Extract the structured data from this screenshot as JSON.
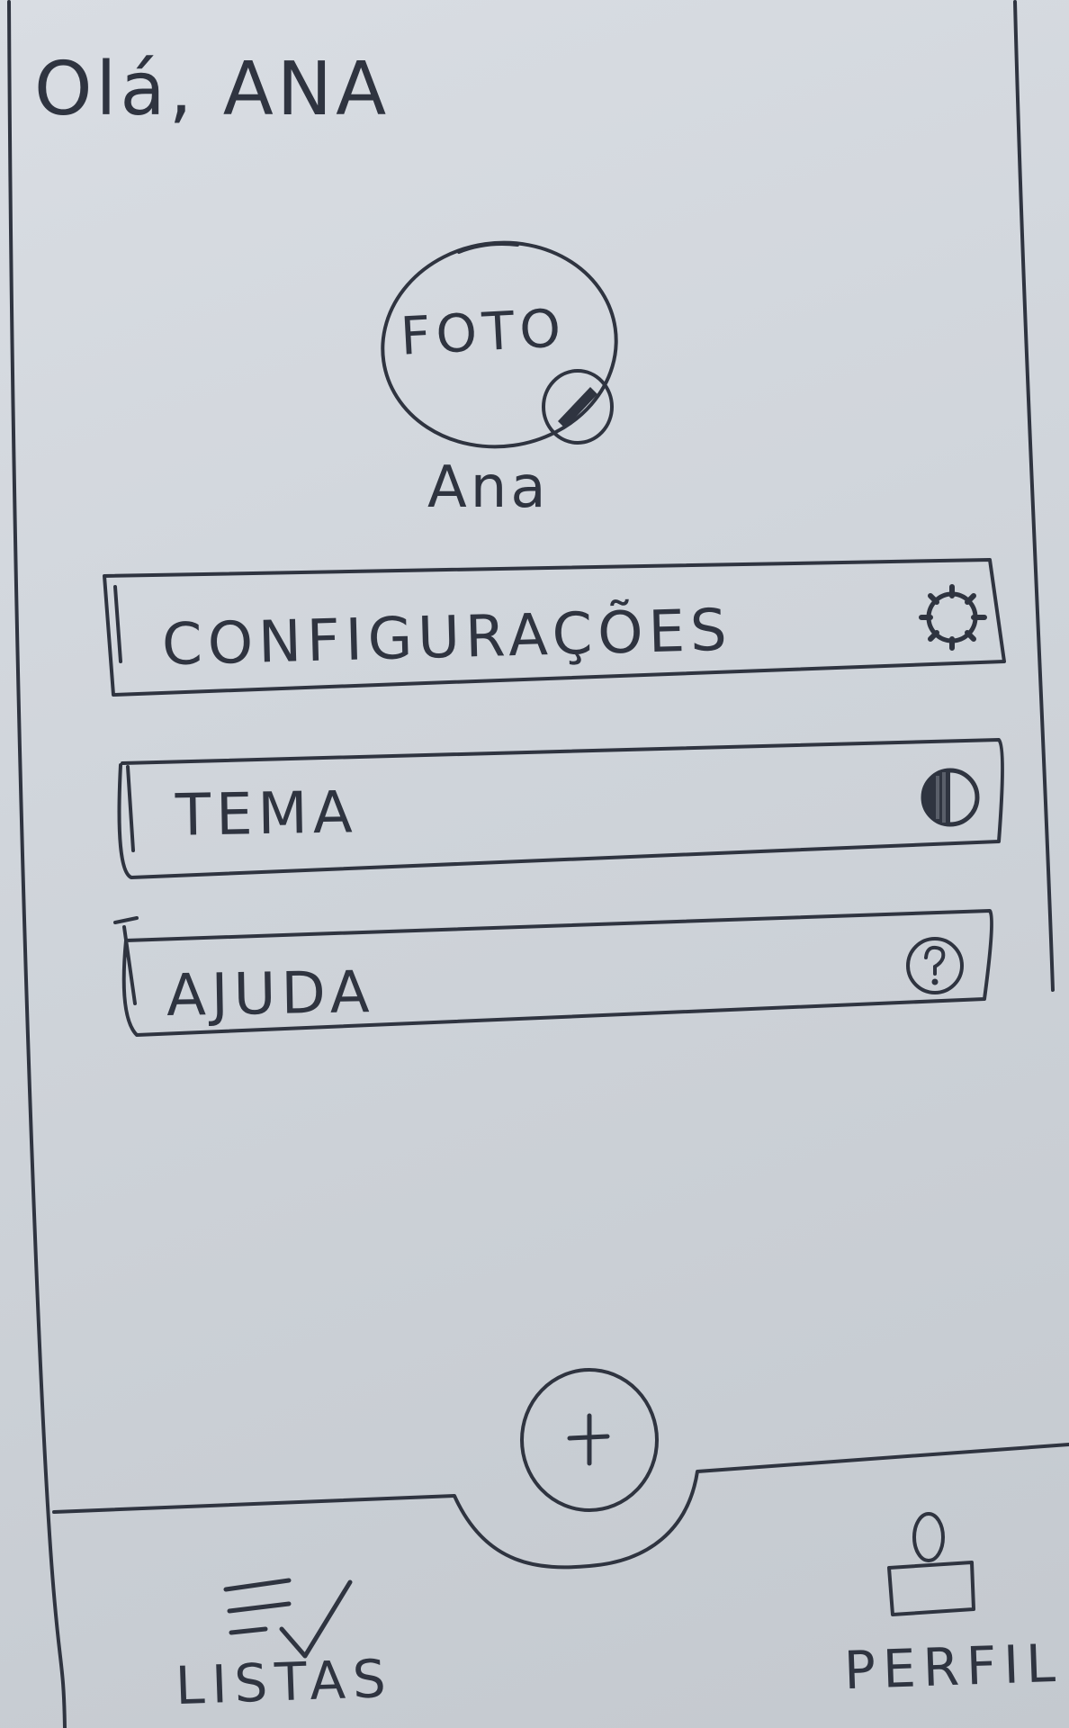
{
  "header": {
    "greeting": "Olá, ANA"
  },
  "profile": {
    "photo_placeholder": "FOTO",
    "name": "Ana",
    "edit_icon": "pencil-icon"
  },
  "menu": {
    "items": [
      {
        "label": "CONFIGURAÇÕES",
        "icon": "gear-icon"
      },
      {
        "label": "TEMA",
        "icon": "theme-icon"
      },
      {
        "label": "AJUDA",
        "icon": "help-icon"
      }
    ]
  },
  "fab": {
    "icon": "plus-icon"
  },
  "bottom_nav": {
    "items": [
      {
        "label": "LISTAS",
        "icon": "checklist-icon"
      },
      {
        "label": "PERFIL",
        "icon": "user-icon"
      }
    ]
  },
  "colors": {
    "ink": "#2f3440",
    "paper": "#d2d7dd",
    "table": "#b7a58c"
  }
}
